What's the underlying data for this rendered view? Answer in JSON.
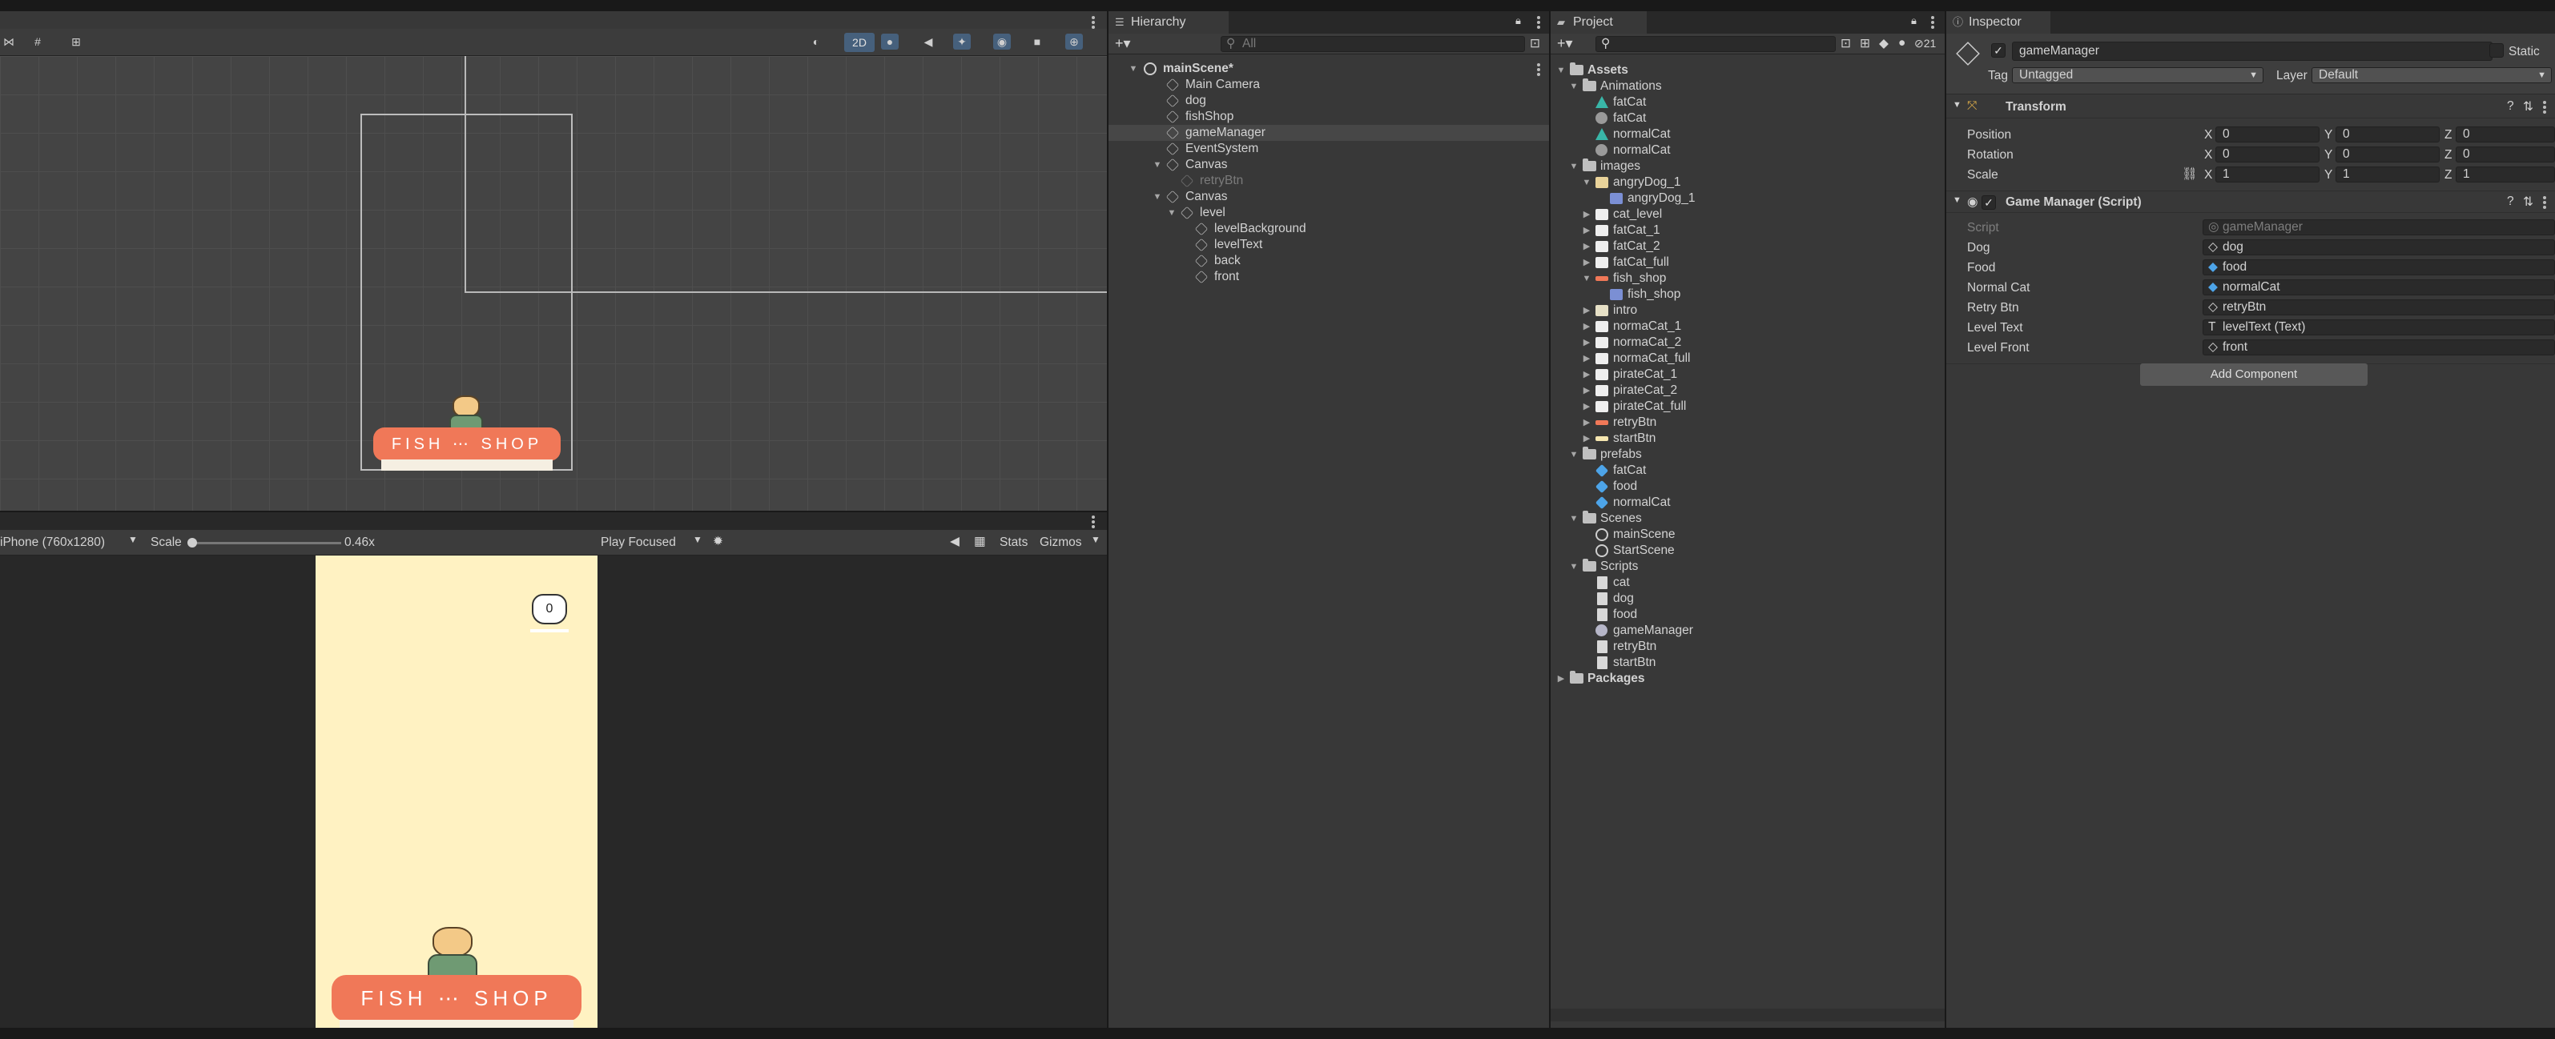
{
  "scene_toolbar": {
    "mode_2d": "2D"
  },
  "game_view": {
    "display": "iPhone (760x1280)",
    "scale_label": "Scale",
    "scale_value": "0.46x",
    "play_mode": "Play Focused",
    "stats": "Stats",
    "gizmos": "Gizmos",
    "score": "0",
    "shop_sign": "FISH ⋯ SHOP"
  },
  "scene_view": {
    "shop_sign": "FISH ⋯ SHOP"
  },
  "hierarchy": {
    "tab": "Hierarchy",
    "search_placeholder": "All",
    "scene": "mainScene*",
    "items": [
      {
        "label": "Main Camera"
      },
      {
        "label": "dog"
      },
      {
        "label": "fishShop"
      },
      {
        "label": "gameManager"
      },
      {
        "label": "EventSystem"
      },
      {
        "label": "Canvas"
      },
      {
        "label": "retryBtn"
      },
      {
        "label": "Canvas"
      },
      {
        "label": "level"
      },
      {
        "label": "levelBackground"
      },
      {
        "label": "levelText"
      },
      {
        "label": "back"
      },
      {
        "label": "front"
      }
    ]
  },
  "project": {
    "tab": "Project",
    "hidden_count": "21",
    "items": [
      {
        "label": "Assets"
      },
      {
        "label": "Animations"
      },
      {
        "label": "fatCat"
      },
      {
        "label": "fatCat"
      },
      {
        "label": "normalCat"
      },
      {
        "label": "normalCat"
      },
      {
        "label": "images"
      },
      {
        "label": "angryDog_1"
      },
      {
        "label": "angryDog_1"
      },
      {
        "label": "cat_level"
      },
      {
        "label": "fatCat_1"
      },
      {
        "label": "fatCat_2"
      },
      {
        "label": "fatCat_full"
      },
      {
        "label": "fish_shop"
      },
      {
        "label": "fish_shop"
      },
      {
        "label": "intro"
      },
      {
        "label": "normaCat_1"
      },
      {
        "label": "normaCat_2"
      },
      {
        "label": "normaCat_full"
      },
      {
        "label": "pirateCat_1"
      },
      {
        "label": "pirateCat_2"
      },
      {
        "label": "pirateCat_full"
      },
      {
        "label": "retryBtn"
      },
      {
        "label": "startBtn"
      },
      {
        "label": "prefabs"
      },
      {
        "label": "fatCat"
      },
      {
        "label": "food"
      },
      {
        "label": "normalCat"
      },
      {
        "label": "Scenes"
      },
      {
        "label": "mainScene"
      },
      {
        "label": "StartScene"
      },
      {
        "label": "Scripts"
      },
      {
        "label": "cat"
      },
      {
        "label": "dog"
      },
      {
        "label": "food"
      },
      {
        "label": "gameManager"
      },
      {
        "label": "retryBtn"
      },
      {
        "label": "startBtn"
      },
      {
        "label": "Packages"
      }
    ]
  },
  "inspector": {
    "tab": "Inspector",
    "object_name": "gameManager",
    "static_label": "Static",
    "tag_label": "Tag",
    "tag_value": "Untagged",
    "layer_label": "Layer",
    "layer_value": "Default",
    "transform": {
      "title": "Transform",
      "position_label": "Position",
      "rotation_label": "Rotation",
      "scale_label": "Scale",
      "axis_x": "X",
      "axis_y": "Y",
      "axis_z": "Z",
      "position": [
        "0",
        "0",
        "0"
      ],
      "rotation": [
        "0",
        "0",
        "0"
      ],
      "scale": [
        "1",
        "1",
        "1"
      ]
    },
    "script_component": {
      "title": "Game Manager (Script)",
      "fields": [
        {
          "label": "Script",
          "value": "gameManager"
        },
        {
          "label": "Dog",
          "value": "dog"
        },
        {
          "label": "Food",
          "value": "food"
        },
        {
          "label": "Normal Cat",
          "value": "normalCat"
        },
        {
          "label": "Retry Btn",
          "value": "retryBtn"
        },
        {
          "label": "Level Text",
          "value": "levelText (Text)"
        },
        {
          "label": "Level Front",
          "value": "front"
        }
      ]
    },
    "add_component": "Add Component"
  }
}
